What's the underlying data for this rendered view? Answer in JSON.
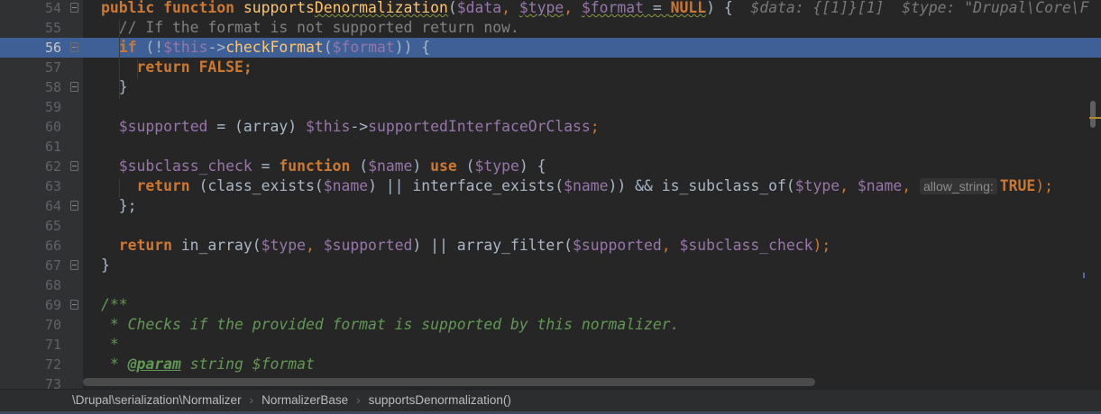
{
  "first_line_number": 54,
  "highlighted_line": 56,
  "lines": [
    [
      [
        "public ",
        "kw"
      ],
      [
        "function ",
        "kw"
      ],
      [
        "supports",
        "fn"
      ],
      [
        "Denormalization",
        "fn warn"
      ],
      [
        "(",
        "p"
      ],
      [
        "$data",
        "var"
      ],
      [
        ", ",
        "kwn"
      ],
      [
        "$type",
        "var warn"
      ],
      [
        ", ",
        "kwn"
      ],
      [
        "$format",
        "var warn"
      ],
      [
        " = ",
        "p warn"
      ],
      [
        "NULL",
        "kw warn"
      ],
      [
        ") {  ",
        "p"
      ],
      [
        "$data: {[1]}[1]  $type: \"Drupal\\Core\\F",
        "hint"
      ]
    ],
    [
      [
        "  // If the format is not supported return now.",
        "cm"
      ]
    ],
    [
      [
        "  if ",
        "kw"
      ],
      [
        "(!",
        "p"
      ],
      [
        "$this",
        "var"
      ],
      [
        "->",
        "p"
      ],
      [
        "checkFormat",
        "fn"
      ],
      [
        "(",
        "p"
      ],
      [
        "$format",
        "var"
      ],
      [
        ")) {",
        "p"
      ]
    ],
    [
      [
        "    return ",
        "kw"
      ],
      [
        "FALSE",
        "kw"
      ],
      [
        ";",
        "kw"
      ]
    ],
    [
      [
        "  }",
        "p"
      ]
    ],
    [],
    [
      [
        "  ",
        "p"
      ],
      [
        "$supported",
        "var"
      ],
      [
        " = (array) ",
        "p"
      ],
      [
        "$this",
        "var"
      ],
      [
        "->",
        "p"
      ],
      [
        "supportedInterfaceOrClass",
        "var"
      ],
      [
        ";",
        "kwn"
      ]
    ],
    [],
    [
      [
        "  ",
        "p"
      ],
      [
        "$subclass_check",
        "var"
      ],
      [
        " = ",
        "p"
      ],
      [
        "function ",
        "kw"
      ],
      [
        "(",
        "p"
      ],
      [
        "$name",
        "var"
      ],
      [
        ") ",
        "p"
      ],
      [
        "use ",
        "kw"
      ],
      [
        "(",
        "p"
      ],
      [
        "$type",
        "var"
      ],
      [
        ") {",
        "p"
      ]
    ],
    [
      [
        "    return ",
        "kw"
      ],
      [
        "(class_exists(",
        "p"
      ],
      [
        "$name",
        "var"
      ],
      [
        ") || interface_exists(",
        "p"
      ],
      [
        "$name",
        "var"
      ],
      [
        ")) && is_subclass_of(",
        "p"
      ],
      [
        "$type",
        "var"
      ],
      [
        ", ",
        "kwn"
      ],
      [
        "$name",
        "var"
      ],
      [
        ", ",
        "kwn"
      ],
      [
        "allow_string:",
        "param"
      ],
      [
        "TRUE",
        "kw"
      ],
      [
        ");",
        "kwn"
      ]
    ],
    [
      [
        "  };",
        "p"
      ]
    ],
    [],
    [
      [
        "  return ",
        "kw"
      ],
      [
        "in_array(",
        "p"
      ],
      [
        "$type",
        "var"
      ],
      [
        ", ",
        "kwn"
      ],
      [
        "$supported",
        "var"
      ],
      [
        ") || array_filter(",
        "p"
      ],
      [
        "$supported",
        "var"
      ],
      [
        ", ",
        "kwn"
      ],
      [
        "$subclass_check",
        "var"
      ],
      [
        ");",
        "kwn"
      ]
    ],
    [
      [
        "}",
        "p"
      ]
    ],
    [],
    [
      [
        "/**",
        "doc"
      ]
    ],
    [
      [
        " * Checks if the provided format is supported by this normalizer.",
        "doc"
      ]
    ],
    [
      [
        " *",
        "doc"
      ]
    ],
    [
      [
        " * ",
        "doc"
      ],
      [
        "@param",
        "tag"
      ],
      [
        " string $format",
        "doc"
      ]
    ],
    []
  ],
  "folds": {
    "54": "open",
    "56": "open",
    "58": "end",
    "62": "open",
    "64": "end",
    "67": "end",
    "69": "open"
  },
  "breadcrumb": [
    "\\Drupal\\serialization\\Normalizer",
    "NormalizerBase",
    "supportsDenormalization()"
  ],
  "breadcrumb_separator": "›"
}
